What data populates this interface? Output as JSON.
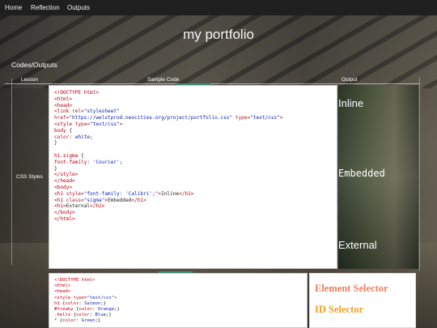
{
  "nav": {
    "items": [
      {
        "label": "Home"
      },
      {
        "label": "Reflection"
      },
      {
        "label": "Outputs"
      }
    ]
  },
  "page": {
    "title": "my portfolio",
    "section_heading": "Codes/Outputs"
  },
  "table": {
    "headers": {
      "lesson": "Lesson",
      "sample_code": "Sample Code",
      "output": "Output"
    },
    "rows": [
      {
        "lesson": "CSS Styles",
        "code_lines": [
          [
            [
              "t",
              "<!DOCTYPE html>"
            ]
          ],
          [
            [
              "t",
              "<html>"
            ]
          ],
          [
            [
              "t",
              "<head>"
            ]
          ],
          [
            [
              "t",
              "<link "
            ],
            [
              "a",
              "rel="
            ],
            [
              "s",
              "\"stylesheet\""
            ]
          ],
          [
            [
              "a",
              "href="
            ],
            [
              "s",
              "\"https://welxtprod.neocities.org/project/portfolio.css\""
            ],
            [
              "d",
              " "
            ],
            [
              "a",
              "type="
            ],
            [
              "s",
              "\"text/css\""
            ],
            [
              "t",
              ">"
            ]
          ],
          [
            [
              "t",
              "<style "
            ],
            [
              "a",
              "type="
            ],
            [
              "s",
              "\"text/css\""
            ],
            [
              "t",
              ">"
            ]
          ],
          [
            [
              "k",
              "body "
            ],
            [
              "d",
              "{"
            ]
          ],
          [
            [
              "p",
              "color"
            ],
            [
              "d",
              ": "
            ],
            [
              "v",
              "white"
            ],
            [
              "d",
              ";"
            ]
          ],
          [
            [
              "d",
              "}"
            ]
          ],
          [
            [
              "d",
              ""
            ]
          ],
          [
            [
              "k",
              "h1.sigma "
            ],
            [
              "d",
              "{"
            ]
          ],
          [
            [
              "p",
              "font-family"
            ],
            [
              "d",
              ": "
            ],
            [
              "v",
              "'Courier'"
            ],
            [
              "d",
              ";"
            ]
          ],
          [
            [
              "d",
              "}"
            ]
          ],
          [
            [
              "t",
              "</style>"
            ]
          ],
          [
            [
              "t",
              "</head>"
            ]
          ],
          [
            [
              "t",
              "<body>"
            ]
          ],
          [
            [
              "t",
              "<h1 "
            ],
            [
              "a",
              "style="
            ],
            [
              "s",
              "\"font-family: 'Calibri';\""
            ],
            [
              "t",
              ">"
            ],
            [
              "d",
              "Inline"
            ],
            [
              "t",
              "</h1>"
            ]
          ],
          [
            [
              "t",
              "<h1 "
            ],
            [
              "a",
              "class="
            ],
            [
              "s",
              "\"sigma\""
            ],
            [
              "t",
              ">"
            ],
            [
              "d",
              "Embedded"
            ],
            [
              "t",
              "</h1>"
            ]
          ],
          [
            [
              "t",
              "<h1>"
            ],
            [
              "d",
              "External"
            ],
            [
              "t",
              "</h1>"
            ]
          ],
          [
            [
              "t",
              "</body>"
            ]
          ],
          [
            [
              "t",
              "</html>"
            ]
          ]
        ],
        "outputs": [
          "Inline",
          "Embedded",
          "External"
        ]
      },
      {
        "code_lines": [
          [
            [
              "t",
              "<!DOCTYPE html>"
            ]
          ],
          [
            [
              "t",
              "<html>"
            ]
          ],
          [
            [
              "t",
              "<head>"
            ]
          ],
          [
            [
              "t",
              "<style "
            ],
            [
              "a",
              "type="
            ],
            [
              "s",
              "\"text/css\""
            ],
            [
              "t",
              ">"
            ]
          ],
          [
            [
              "k",
              "h1 "
            ],
            [
              "d",
              "{"
            ],
            [
              "p",
              "color"
            ],
            [
              "d",
              ": "
            ],
            [
              "v",
              "Salmon"
            ],
            [
              "d",
              ";}"
            ]
          ],
          [
            [
              "k",
              "#freaky "
            ],
            [
              "d",
              "{"
            ],
            [
              "p",
              "color"
            ],
            [
              "d",
              ": "
            ],
            [
              "v",
              "Orange"
            ],
            [
              "d",
              ";}"
            ]
          ],
          [
            [
              "k",
              ".hello "
            ],
            [
              "d",
              "{"
            ],
            [
              "p",
              "color"
            ],
            [
              "d",
              ": "
            ],
            [
              "v",
              "Blue"
            ],
            [
              "d",
              ";}"
            ]
          ],
          [
            [
              "k",
              "* "
            ],
            [
              "d",
              "{"
            ],
            [
              "p",
              "color"
            ],
            [
              "d",
              ": "
            ],
            [
              "v",
              "Green"
            ],
            [
              "d",
              ";}"
            ]
          ]
        ],
        "outputs": [
          "Element Selector",
          "ID Selector"
        ]
      }
    ]
  },
  "colors": {
    "navbar": "#1f1f1f",
    "accent": "#3a8f74",
    "element_selector": "#f08060",
    "id_selector": "#f0a020"
  }
}
